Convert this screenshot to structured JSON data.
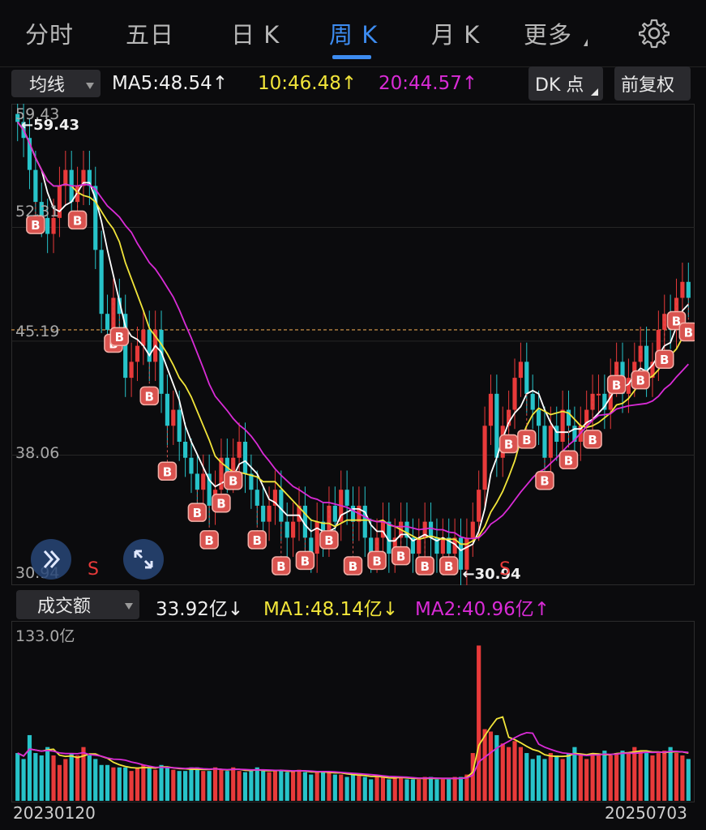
{
  "tabs": [
    "分时",
    "五日",
    "日 K",
    "周 K",
    "月 K",
    "更多"
  ],
  "active_tab": "周 K",
  "toolbar": {
    "indicator_select": "均线",
    "ma5": "MA5:48.54",
    "ma10": "10:46.48",
    "ma20": "20:44.57",
    "arrow_up": "↑",
    "dk_button": "DK 点",
    "adjust_button": "前复权"
  },
  "colors": {
    "up": "#e83a3a",
    "down": "#27c3c9",
    "ma5": "#ffffff",
    "ma10": "#f2e53a",
    "ma20": "#d92bd6",
    "accent": "#3d8cf0",
    "signal_b": "#d9534f"
  },
  "price_axis": {
    "ticks": [
      "59.43",
      "52.31",
      "45.19",
      "38.06",
      "30.94"
    ],
    "high_label": "59.43",
    "low_label": "30.94",
    "current_line": 46.0
  },
  "signals": {
    "s_label": "S",
    "b_label": "B"
  },
  "volume": {
    "indicator_select": "成交额",
    "value": "33.92亿",
    "ma1": "MA1:48.14亿",
    "ma2": "MA2:40.96亿",
    "arrow_down": "↓",
    "arrow_up": "↑",
    "max_label": "133.0亿"
  },
  "dates": {
    "start": "20230120",
    "end": "20250703"
  },
  "chart_data": {
    "type": "candlestick",
    "x_range": [
      "20230120",
      "20250703"
    ],
    "ylim": [
      30.94,
      59.43
    ],
    "ma_lines": [
      {
        "name": "MA5",
        "current": 48.54
      },
      {
        "name": "MA10",
        "current": 46.48
      },
      {
        "name": "MA20",
        "current": 44.57
      }
    ],
    "close_series": [
      59,
      58,
      56,
      54,
      53,
      52,
      53,
      55,
      56,
      54,
      55,
      56,
      55,
      51,
      47,
      46,
      48,
      47,
      43,
      44,
      45,
      46,
      44,
      46,
      42,
      40,
      41,
      39,
      38,
      37,
      36,
      37,
      35,
      36,
      38,
      37,
      38,
      39,
      37,
      36,
      35,
      34,
      35,
      36,
      34,
      33,
      34,
      35,
      33,
      32,
      34,
      33,
      35,
      34,
      36,
      35,
      34,
      35,
      33,
      32,
      33,
      34,
      32,
      33,
      34,
      33,
      32,
      33,
      34,
      33,
      32,
      33,
      32,
      33,
      31,
      33,
      34,
      36,
      40,
      42,
      38,
      40,
      41,
      43,
      44,
      42,
      41,
      40,
      38,
      40,
      39,
      41,
      40,
      39,
      40,
      41,
      42,
      42,
      41,
      43,
      44,
      42,
      43,
      44,
      45,
      43,
      44,
      46,
      47,
      46,
      48,
      49,
      48
    ],
    "volume_bars": [
      40,
      35,
      55,
      40,
      38,
      45,
      38,
      30,
      35,
      40,
      38,
      45,
      38,
      35,
      30,
      30,
      28,
      28,
      28,
      25,
      28,
      30,
      28,
      26,
      30,
      28,
      26,
      25,
      25,
      28,
      28,
      25,
      25,
      28,
      26,
      25,
      28,
      25,
      24,
      25,
      28,
      25,
      24,
      25,
      26,
      24,
      25,
      26,
      24,
      22,
      24,
      25,
      24,
      22,
      22,
      20,
      22,
      22,
      20,
      18,
      20,
      20,
      18,
      20,
      20,
      18,
      18,
      18,
      20,
      20,
      18,
      18,
      18,
      20,
      20,
      22,
      40,
      130,
      60,
      58,
      55,
      48,
      45,
      50,
      45,
      40,
      35,
      38,
      35,
      40,
      38,
      35,
      40,
      45,
      38,
      35,
      40,
      38,
      42,
      38,
      40,
      42,
      40,
      45,
      42,
      40,
      38,
      40,
      42,
      45,
      40,
      38,
      35
    ],
    "volume_ma1_current": 48.14,
    "volume_ma2_current": 40.96,
    "volume_current": 33.92,
    "volume_max": 133.0
  }
}
